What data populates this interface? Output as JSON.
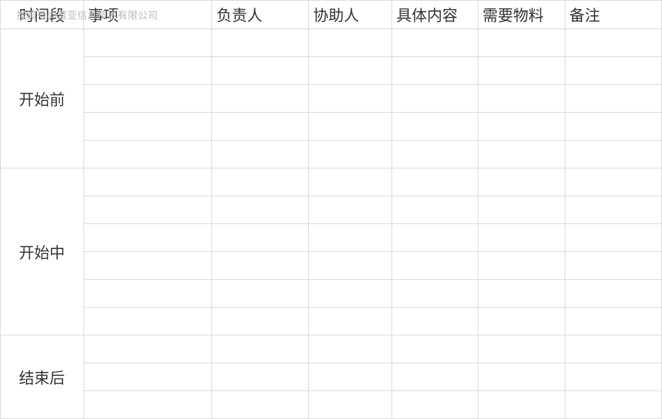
{
  "watermark": "搜狐号@雷亚信息技术有限公司",
  "headers": [
    "时间段",
    "事项",
    "负责人",
    "协助人",
    "具体内容",
    "需要物料",
    "备注"
  ],
  "sections": [
    {
      "label": "开始前",
      "rows": 5
    },
    {
      "label": "开始中",
      "rows": 6
    },
    {
      "label": "结束后",
      "rows": 3
    }
  ]
}
